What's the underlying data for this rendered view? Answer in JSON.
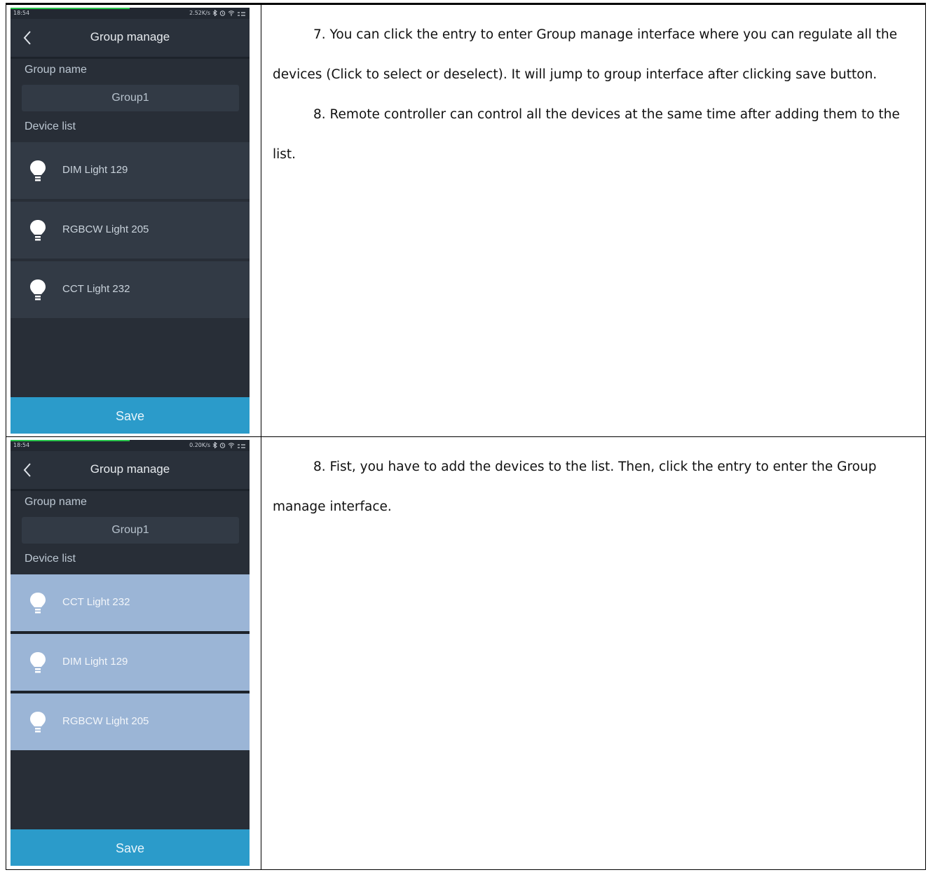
{
  "panels": [
    {
      "statusbar": {
        "time": "18:54",
        "speed": "2.52K/s"
      },
      "title": "Group manage",
      "group_name_label": "Group name",
      "group_name_value": "Group1",
      "device_list_label": "Device list",
      "devices": [
        {
          "name": "DIM Light 129",
          "selected": false
        },
        {
          "name": "RGBCW Light 205",
          "selected": false
        },
        {
          "name": "CCT Light 232",
          "selected": false
        }
      ],
      "save_label": "Save",
      "paragraphs": [
        "7. You can click the entry to enter Group manage interface where you can regulate all the devices (Click to select or deselect). It will jump to group interface after clicking save button.",
        "8. Remote controller can control all the devices at the same time after adding them to the list."
      ]
    },
    {
      "statusbar": {
        "time": "18:54",
        "speed": "0.20K/s"
      },
      "title": "Group manage",
      "group_name_label": "Group name",
      "group_name_value": "Group1",
      "device_list_label": "Device list",
      "devices": [
        {
          "name": "CCT Light 232",
          "selected": true
        },
        {
          "name": "DIM Light 129",
          "selected": true
        },
        {
          "name": "RGBCW Light 205",
          "selected": true
        }
      ],
      "save_label": "Save",
      "paragraphs": [
        "8. Fist, you have to add the devices to the list. Then, click the entry to enter the Group manage interface."
      ]
    }
  ],
  "colors": {
    "app_background": "#282e37",
    "row_background": "#323a45",
    "row_selected": "#9bb5d6",
    "save_button": "#2b9bca",
    "progress": "#27c34a"
  }
}
